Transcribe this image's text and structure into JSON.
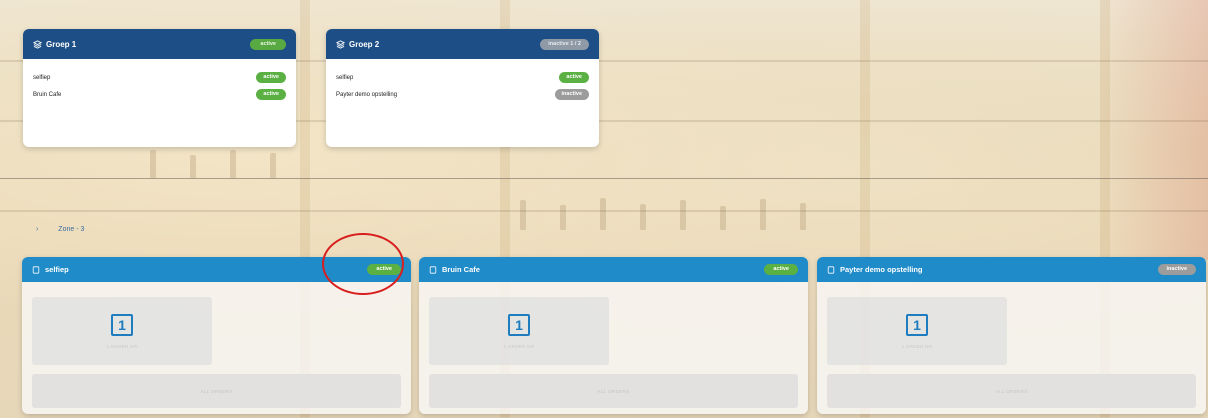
{
  "groups": [
    {
      "title": "Groep 1",
      "status": "active",
      "items": [
        {
          "name": "selfiep",
          "status": "active"
        },
        {
          "name": "Bruin Cafe",
          "status": "active"
        }
      ]
    },
    {
      "title": "Groep 2",
      "status": "inactive 1 / 2",
      "items": [
        {
          "name": "selfiep",
          "status": "active"
        },
        {
          "name": "Payter demo opstelling",
          "status": "inactive"
        }
      ]
    }
  ],
  "zone": {
    "label": "Zone - 3"
  },
  "terminals": [
    {
      "title": "selfiep",
      "status": "active",
      "tile_number": "1",
      "tile_caption": "1 ORDER NR",
      "button_label": "ALL ORDERS"
    },
    {
      "title": "Bruin Cafe",
      "status": "active",
      "tile_number": "1",
      "tile_caption": "1 ORDER NR",
      "button_label": "ALL ORDERS"
    },
    {
      "title": "Payter demo opstelling",
      "status": "inactive",
      "tile_number": "1",
      "tile_caption": "1 ORDER NR",
      "button_label": "ALL ORDERS"
    }
  ],
  "colors": {
    "group_header": "#1d4f86",
    "terminal_header": "#1f8bc8",
    "active": "#5bb043",
    "inactive": "#9c9c9c",
    "highlight": "#d81e1e"
  },
  "icons": {
    "group": "layers-icon",
    "terminal": "tablet-icon"
  }
}
